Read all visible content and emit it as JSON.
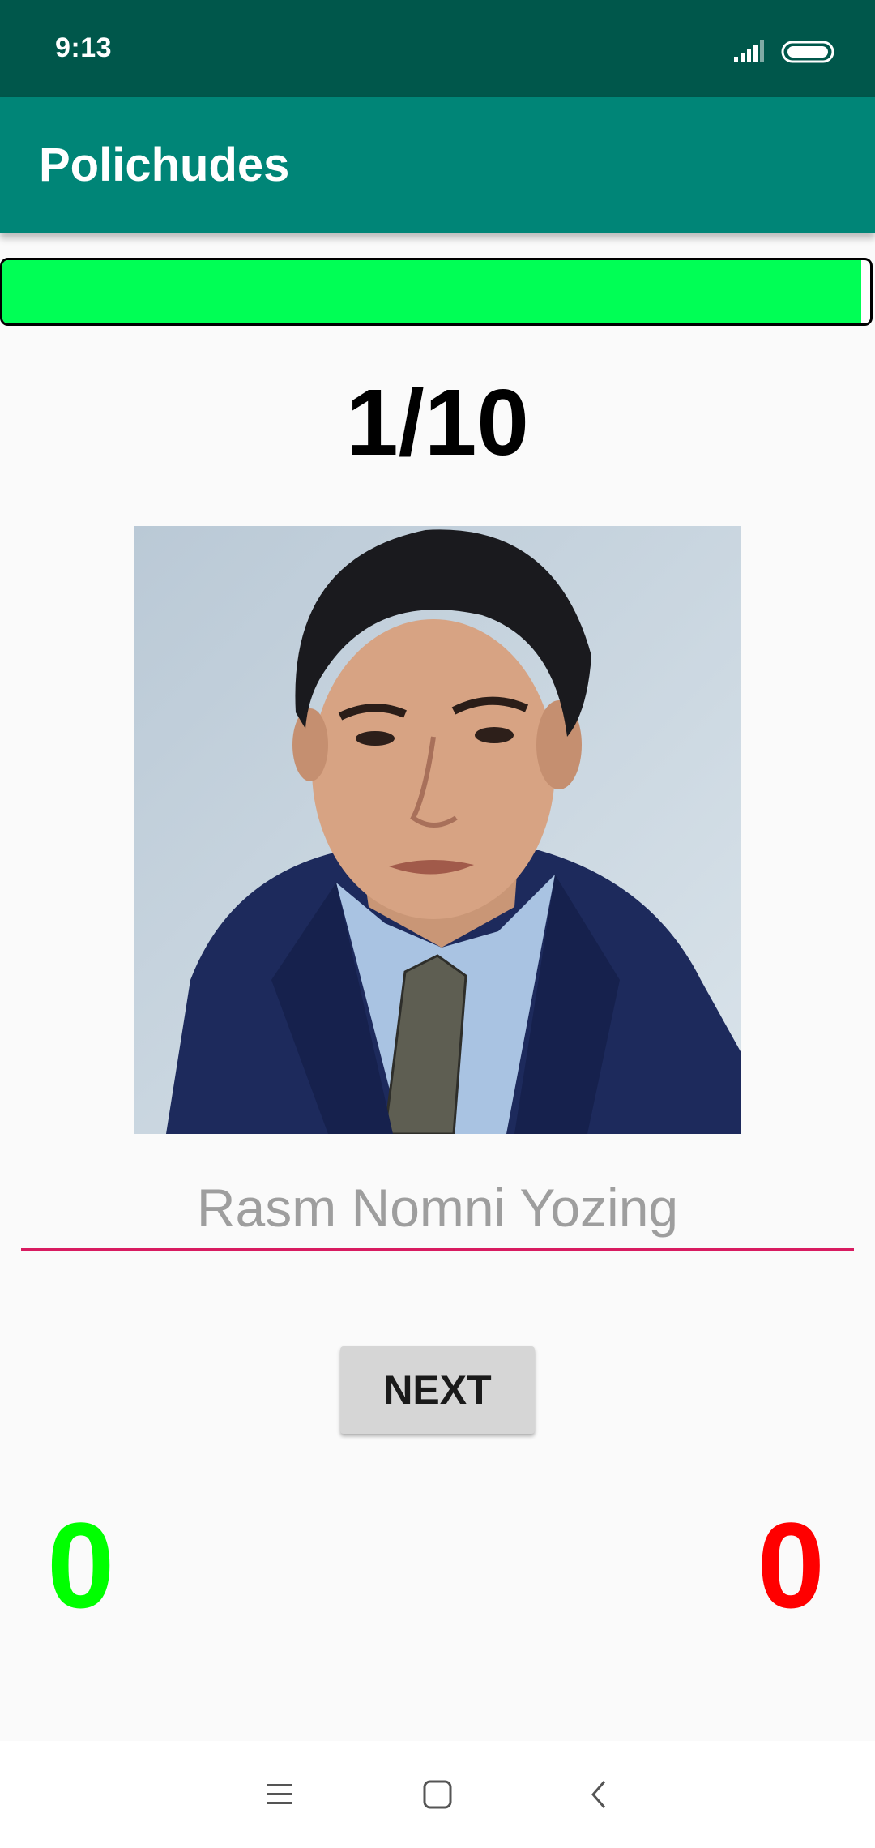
{
  "status_bar": {
    "time": "9:13",
    "icons": [
      "signal-icon",
      "battery-icon"
    ]
  },
  "app_bar": {
    "title": "Polichudes"
  },
  "progress": {
    "fraction": 0.99,
    "color": "#00ff55"
  },
  "quiz": {
    "counter": "1/10",
    "image": "portrait of a man in a dark suit and tie",
    "answer_placeholder": "Rasm Nomni Yozing",
    "answer_value": "",
    "next_label": "NEXT"
  },
  "scores": {
    "correct": "0",
    "wrong": "0",
    "correct_color": "#00ff00",
    "wrong_color": "#ff0000"
  },
  "nav_bar": {
    "icons": [
      "menu-icon",
      "home-icon",
      "back-icon"
    ]
  },
  "colors": {
    "status_bar": "#00574b",
    "app_bar": "#008577",
    "accent": "#d81b60"
  }
}
